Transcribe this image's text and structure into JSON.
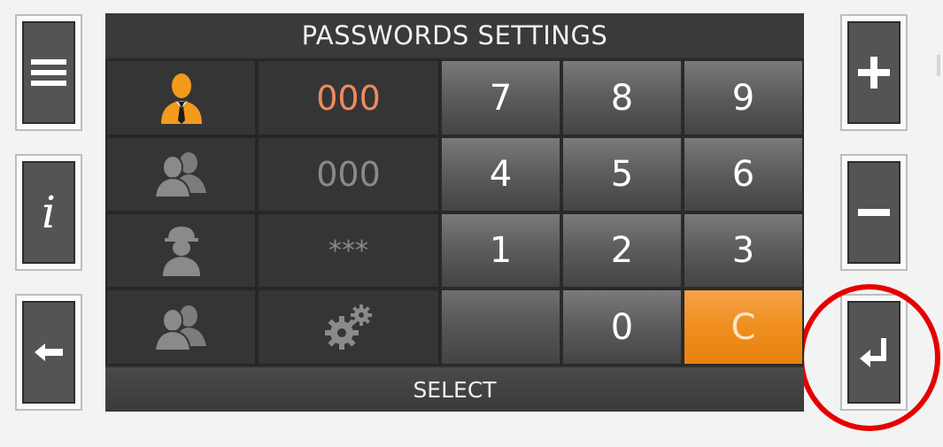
{
  "screen": {
    "title": "PASSWORDS SETTINGS",
    "bottom_button": "SELECT"
  },
  "side_buttons": {
    "left": [
      {
        "name": "menu",
        "icon": "menu-icon"
      },
      {
        "name": "info",
        "icon": "info-icon",
        "glyph": "i"
      },
      {
        "name": "back",
        "icon": "arrow-left-icon"
      }
    ],
    "right": [
      {
        "name": "plus",
        "icon": "plus-icon"
      },
      {
        "name": "minus",
        "icon": "minus-icon"
      },
      {
        "name": "enter",
        "icon": "enter-icon",
        "highlighted": true
      }
    ]
  },
  "users": [
    {
      "icon": "user-manager-icon",
      "value": "000",
      "active": true,
      "value_color": "#ef8a5e"
    },
    {
      "icon": "user-group-icon",
      "value": "000",
      "active": false,
      "value_color": "#8a8a8a"
    },
    {
      "icon": "technician-icon",
      "value": "***",
      "active": false,
      "value_color": "#8a8a8a"
    },
    {
      "icon": "user-group-icon",
      "value": "",
      "value_icon": "gears-icon",
      "active": false
    }
  ],
  "keypad": {
    "rows": [
      [
        "7",
        "8",
        "9"
      ],
      [
        "4",
        "5",
        "6"
      ],
      [
        "1",
        "2",
        "3"
      ],
      [
        "",
        "0",
        "C"
      ]
    ]
  },
  "colors": {
    "accent_orange": "#f0891a",
    "active_user": "#f29a1b",
    "inactive_icon": "#7c7c7c",
    "highlight_circle": "#e60000"
  }
}
